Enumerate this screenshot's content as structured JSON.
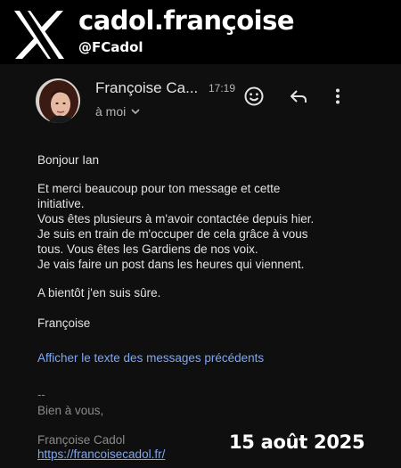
{
  "overlay": {
    "display_name": "cadol.françoise",
    "handle": "@FCadol",
    "logo_icon": "x-logo-icon",
    "date": "15 août 2025"
  },
  "email": {
    "sender": "Françoise Ca...",
    "time": "17:19",
    "recipient": "à moi",
    "actions": {
      "emoji_icon": "smiley-icon",
      "reply_icon": "reply-arrow-icon",
      "more_icon": "more-vert-icon"
    },
    "body": {
      "greeting": "Bonjour Ian",
      "paragraph_1_lines": [
        "Et merci beaucoup pour ton message et cette",
        "initiative.",
        "Vous êtes plusieurs à m'avoir contactée depuis hier.",
        "Je suis en train de m'occuper de cela grâce à vous",
        "tous. Vous êtes les Gardiens de nos voix.",
        "Je vais faire un post dans les heures qui viennent."
      ],
      "paragraph_2": "A bientôt j'en suis sûre.",
      "signoff": "Françoise"
    },
    "show_previous": "Afficher le texte des messages précédents",
    "signature": {
      "separator": "--",
      "regards": "Bien à vous,",
      "name": "Françoise Cadol",
      "link": "https://francoisecadol.fr/"
    }
  },
  "colors": {
    "background": "#000000",
    "email_background": "#0f0f0f",
    "text_primary": "#e3e3e3",
    "text_secondary": "#b5b5b5",
    "link": "#7ea7f3"
  }
}
